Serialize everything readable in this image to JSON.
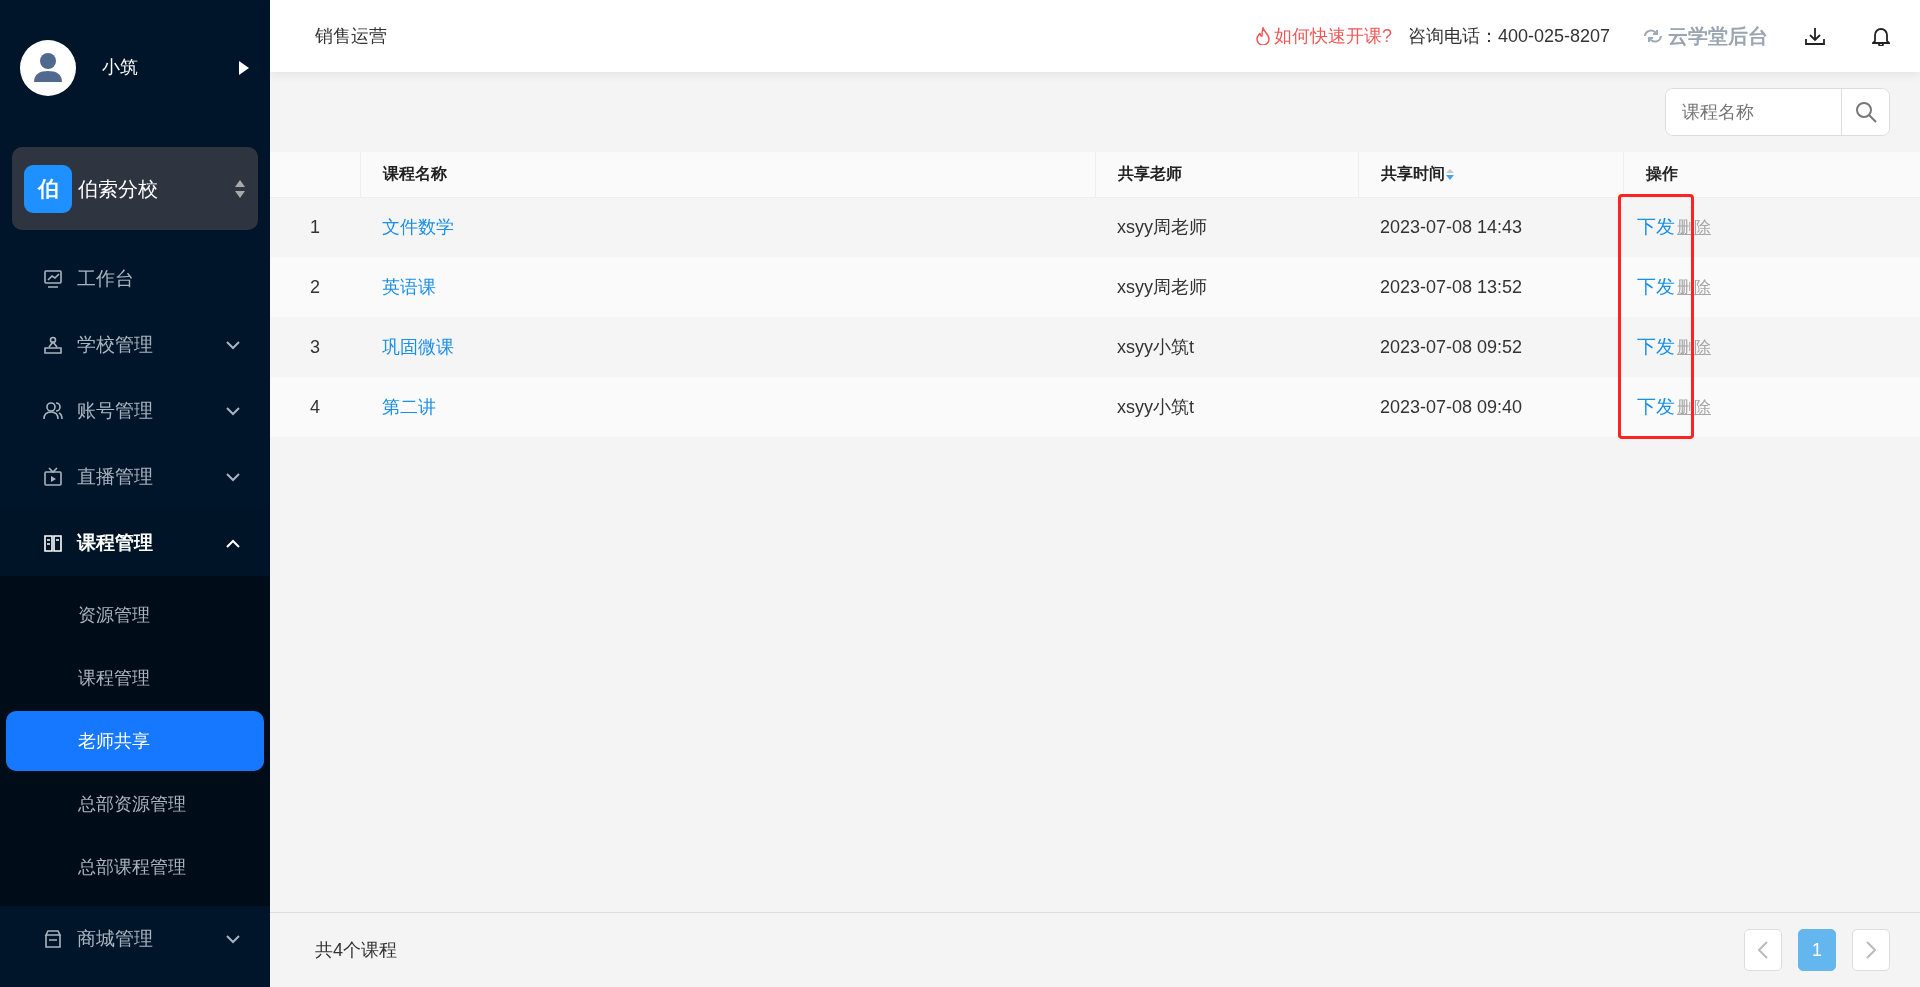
{
  "user": {
    "name": "小筑"
  },
  "school": {
    "badge": "伯",
    "name": "伯索分校"
  },
  "menu": [
    {
      "label": "工作台"
    },
    {
      "label": "学校管理",
      "expanded": false
    },
    {
      "label": "账号管理",
      "expanded": false
    },
    {
      "label": "直播管理",
      "expanded": false
    },
    {
      "label": "课程管理",
      "expanded": true,
      "children": [
        {
          "label": "资源管理",
          "selected": false
        },
        {
          "label": "课程管理",
          "selected": false
        },
        {
          "label": "老师共享",
          "selected": true
        },
        {
          "label": "总部资源管理",
          "selected": false
        },
        {
          "label": "总部课程管理",
          "selected": false
        }
      ]
    },
    {
      "label": "商城管理",
      "expanded": false
    }
  ],
  "header": {
    "title": "销售运营",
    "help_link": "如何快速开课?",
    "phone": "咨询电话：400-025-8207",
    "brand": "云学堂后台"
  },
  "search": {
    "placeholder": "课程名称"
  },
  "table": {
    "columns": [
      {},
      {
        "label": "课程名称"
      },
      {
        "label": "共享老师"
      },
      {
        "label": "共享时间",
        "sorted": true
      },
      {
        "label": "操作"
      }
    ],
    "rows": [
      {
        "index": "1",
        "course": "文件数学",
        "teacher": "xsyy周老师",
        "time": "2023-07-08 14:43",
        "actions": [
          {
            "label": "下发",
            "disabled": false
          },
          {
            "label": "删除",
            "disabled": true
          }
        ]
      },
      {
        "index": "2",
        "course": "英语课",
        "teacher": "xsyy周老师",
        "time": "2023-07-08 13:52",
        "actions": [
          {
            "label": "下发",
            "disabled": false
          },
          {
            "label": "删除",
            "disabled": true
          }
        ]
      },
      {
        "index": "3",
        "course": "巩固微课",
        "teacher": "xsyy小筑t",
        "time": "2023-07-08 09:52",
        "actions": [
          {
            "label": "下发",
            "disabled": false
          },
          {
            "label": "删除",
            "disabled": true
          }
        ]
      },
      {
        "index": "4",
        "course": "第二讲",
        "teacher": "xsyy小筑t",
        "time": "2023-07-08 09:40",
        "actions": [
          {
            "label": "下发",
            "disabled": false
          },
          {
            "label": "删除",
            "disabled": true
          }
        ]
      }
    ]
  },
  "footer": {
    "total": "共4个课程",
    "pages": [
      {
        "label": "1",
        "selected": true
      }
    ]
  }
}
